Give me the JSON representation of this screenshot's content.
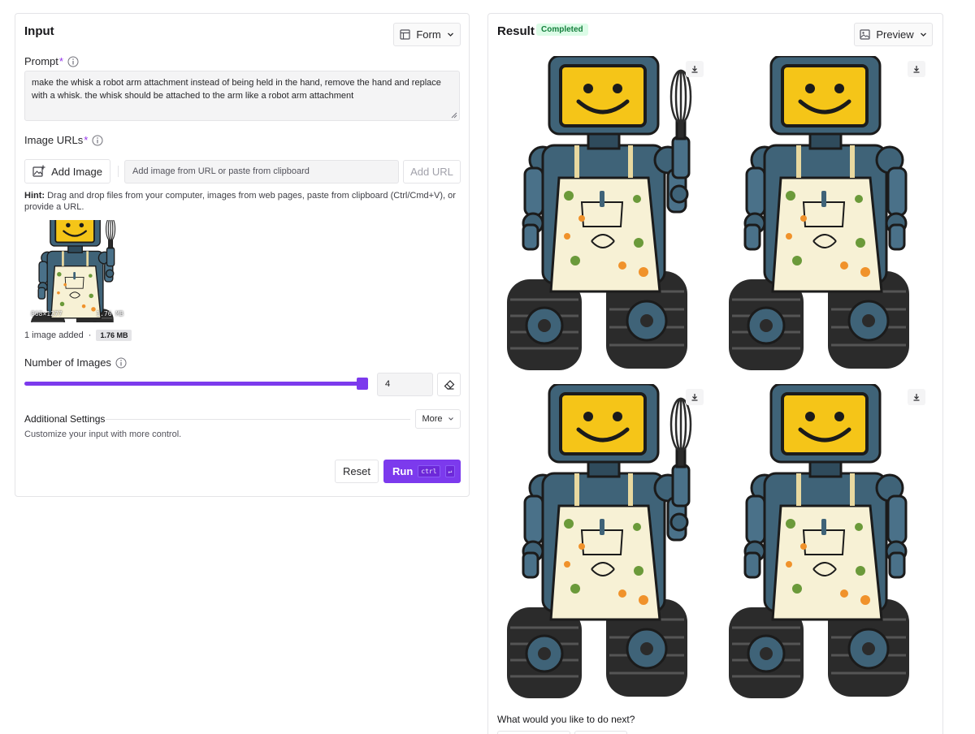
{
  "input_panel": {
    "title": "Input",
    "form_button": "Form",
    "prompt_label": "Prompt",
    "prompt_required": "*",
    "prompt_value": "make the whisk a robot arm attachment instead of being held in the hand, remove the hand and replace with a whisk. the whisk should be attached to the arm like a robot arm attachment",
    "image_urls_label": "Image URLs",
    "image_urls_required": "*",
    "add_image_button": "Add Image",
    "url_placeholder": "Add image from URL or paste from clipboard",
    "add_url_button": "Add URL",
    "hint_label": "Hint:",
    "hint_text": "Drag and drop files from your computer, images from web pages, paste from clipboard (Ctrl/Cmd+V), or provide a URL.",
    "thumb_dims": "868×1277",
    "thumb_size": "1.76 MB",
    "images_added": "1 image added",
    "images_added_sep": "·",
    "images_added_size": "1.76 MB",
    "num_images_label": "Number of Images",
    "num_images_value": "4",
    "num_images_fraction": 1.0,
    "additional_settings_label": "Additional Settings",
    "additional_settings_sub": "Customize your input with more control.",
    "more_button": "More",
    "reset_button": "Reset",
    "run_button": "Run",
    "run_kbd_mod": "ctrl",
    "run_kbd_key": "↵"
  },
  "result_panel": {
    "title": "Result",
    "status_badge": "Completed",
    "preview_button": "Preview",
    "images": [
      {
        "variant": "whisk-held"
      },
      {
        "variant": "no-whisk"
      },
      {
        "variant": "whisk-held"
      },
      {
        "variant": "no-whisk"
      }
    ],
    "next_question": "What would you like to do next?"
  },
  "colors": {
    "accent": "#7c3aed",
    "completed_bg": "#dcfce7",
    "completed_text": "#15803d",
    "robot_body": "#3f6378",
    "robot_screen": "#f5c518",
    "apron": "#f7f1d5",
    "tracks": "#2b2b2b"
  }
}
